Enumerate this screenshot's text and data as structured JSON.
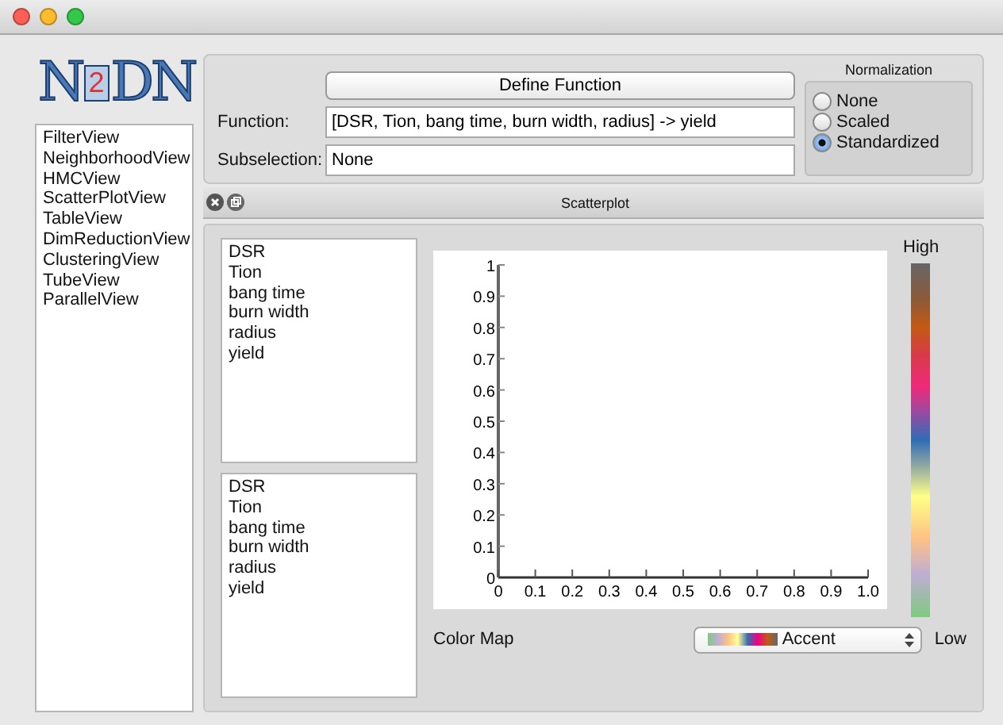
{
  "logo": {
    "left": "N",
    "mark": "2",
    "right": "DN"
  },
  "views": [
    "FilterView",
    "NeighborhoodView",
    "HMCView",
    "ScatterPlotView",
    "TableView",
    "DimReductionView",
    "ClusteringView",
    "TubeView",
    "ParallelView"
  ],
  "define_button": "Define Function",
  "function": {
    "label": "Function:",
    "value": "[DSR, Tion, bang time, burn width, radius] -> yield"
  },
  "subselection": {
    "label": "Subselection:",
    "value": "None"
  },
  "normalization": {
    "title": "Normalization",
    "options": [
      {
        "label": "None",
        "selected": false
      },
      {
        "label": "Scaled",
        "selected": false
      },
      {
        "label": "Standardized",
        "selected": true
      }
    ]
  },
  "panel_title": "Scatterplot",
  "list_top": [
    "DSR",
    "Tion",
    "bang time",
    "burn width",
    "radius",
    "yield"
  ],
  "list_bottom": [
    "DSR",
    "Tion",
    "bang time",
    "burn width",
    "radius",
    "yield"
  ],
  "chart_data": {
    "type": "scatter",
    "xlim": [
      0,
      1
    ],
    "ylim": [
      0,
      1
    ],
    "xticks": [
      0,
      0.1,
      0.2,
      0.3,
      0.4,
      0.5,
      0.6,
      0.7,
      0.8,
      0.9,
      {
        "value": 1,
        "label": "1.0"
      }
    ],
    "yticks": [
      0,
      0.1,
      0.2,
      0.3,
      0.4,
      0.5,
      0.6,
      0.7,
      0.8,
      0.9,
      1
    ]
  },
  "color_map": {
    "label": "Color Map",
    "value": "Accent",
    "high": "High",
    "low": "Low"
  }
}
